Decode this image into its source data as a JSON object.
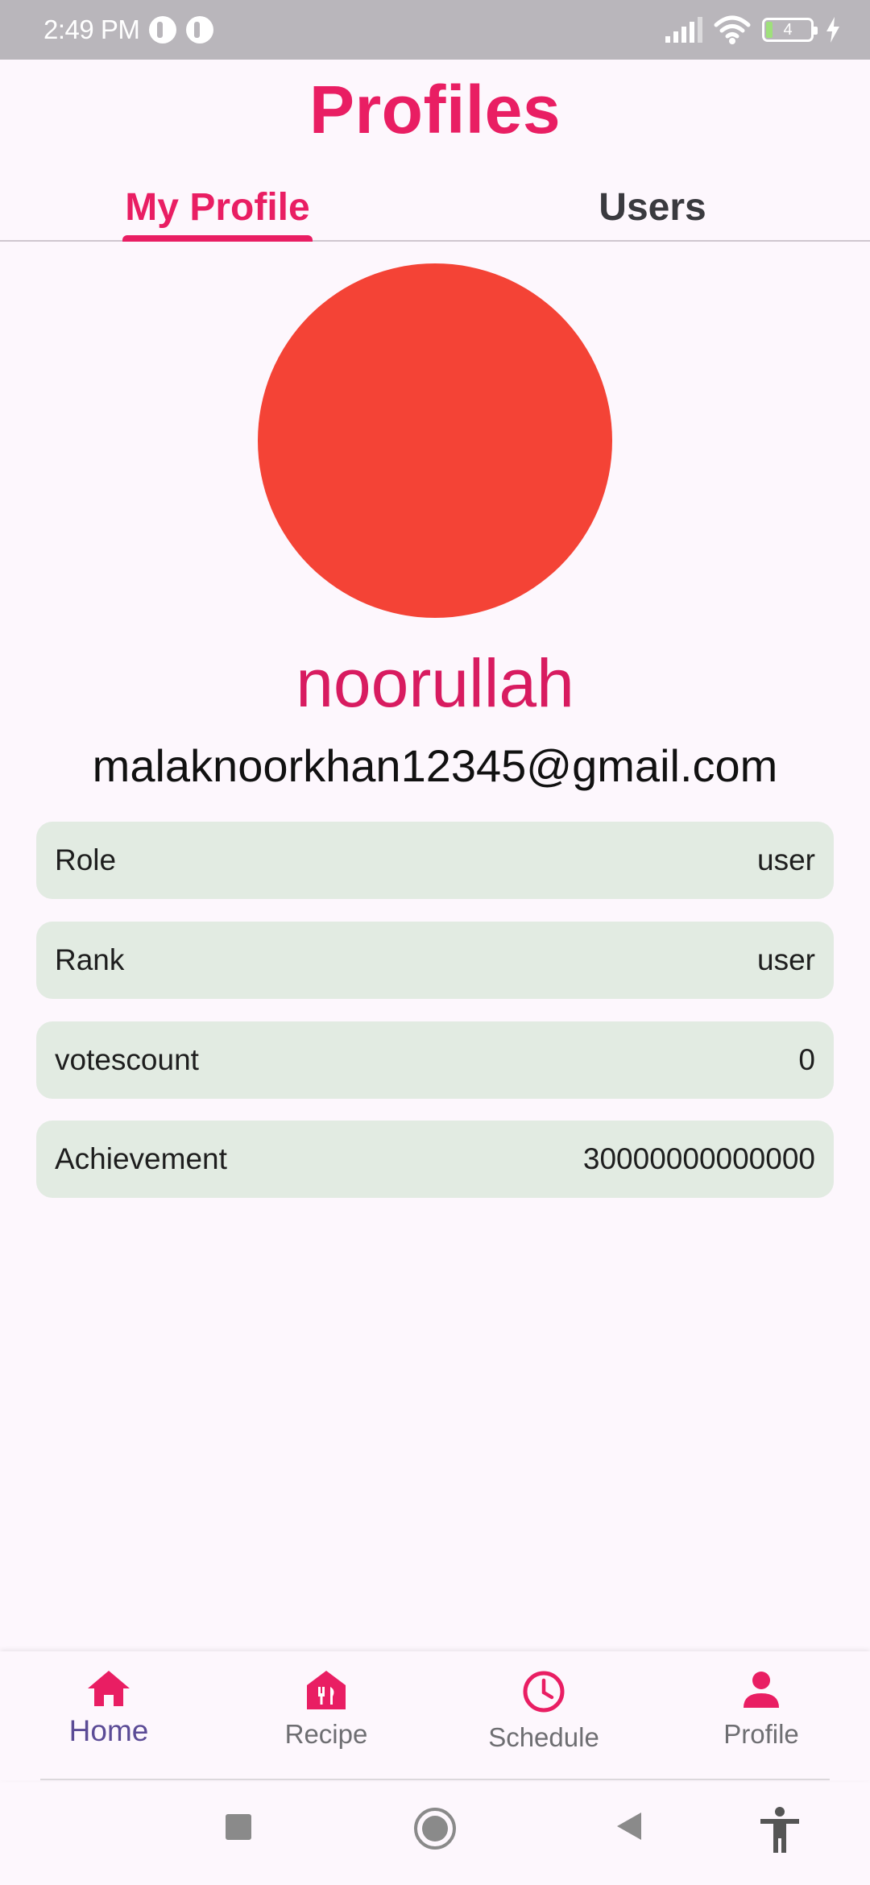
{
  "status_bar": {
    "time": "2:49 PM",
    "battery_level": "4",
    "icons": [
      "notification-icon",
      "notification-icon",
      "signal-icon",
      "wifi-icon",
      "battery-icon",
      "charging-icon"
    ]
  },
  "header": {
    "title": "Profiles"
  },
  "tabs": [
    {
      "label": "My Profile",
      "active": true
    },
    {
      "label": "Users",
      "active": false
    }
  ],
  "profile": {
    "username": "noorullah",
    "email": "malaknoorkhan12345@gmail.com",
    "avatar_color": "#f44336",
    "fields": [
      {
        "label": "Role",
        "value": "user"
      },
      {
        "label": "Rank",
        "value": "user"
      },
      {
        "label": "votescount",
        "value": "0"
      },
      {
        "label": "Achievement",
        "value": "30000000000000"
      }
    ]
  },
  "bottom_nav": {
    "items": [
      {
        "label": "Home",
        "icon": "home-icon",
        "active": true
      },
      {
        "label": "Recipe",
        "icon": "recipe-icon",
        "active": false
      },
      {
        "label": "Schedule",
        "icon": "clock-icon",
        "active": false
      },
      {
        "label": "Profile",
        "icon": "person-icon",
        "active": false
      }
    ]
  },
  "system_nav": {
    "buttons": [
      "recents-icon",
      "home-circle-icon",
      "back-icon",
      "accessibility-icon"
    ]
  },
  "colors": {
    "accent": "#e91e63",
    "active_nav_label": "#5b4b96",
    "row_background": "#e2ebe2",
    "page_background": "#fdf7fd"
  }
}
